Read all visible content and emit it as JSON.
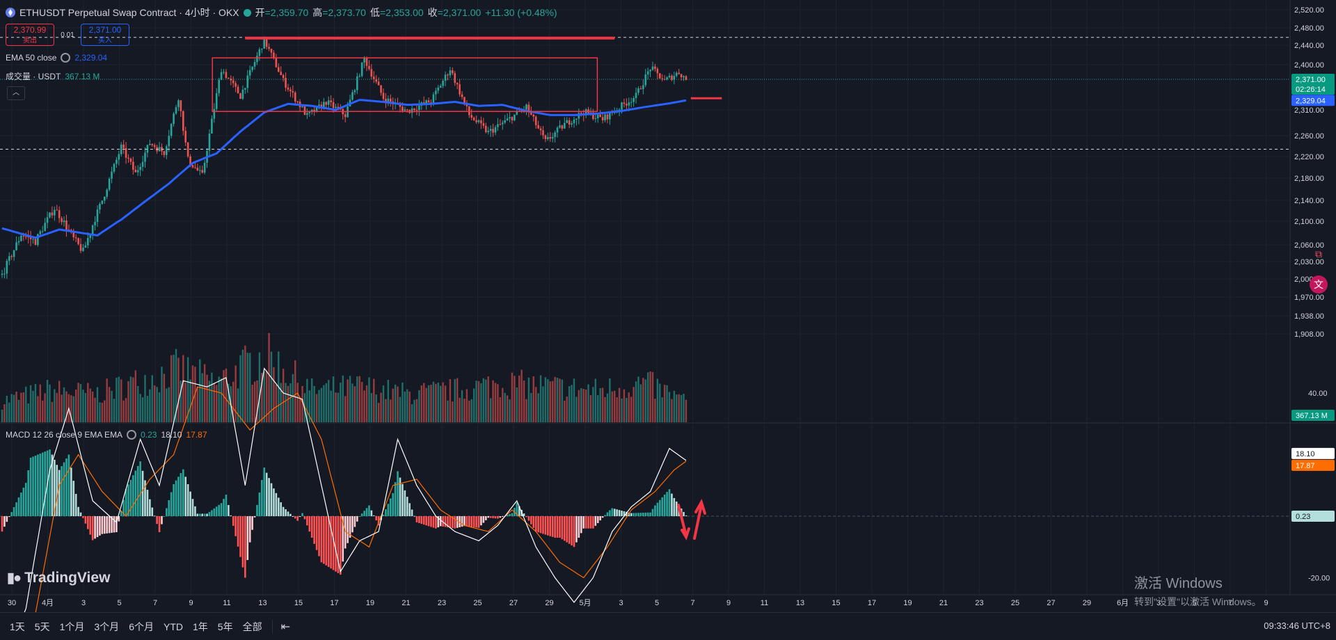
{
  "header": {
    "symbol": "ETHUSDT Perpetual Swap Contract · 4小时 · OKX",
    "open_label": "开",
    "open_value": "=2,359.70",
    "high_label": "高",
    "high_value": "=2,373.70",
    "low_label": "低",
    "low_value": "=2,353.00",
    "close_label": "收",
    "close_value": "=2,371.00",
    "change": "+11.30 (+0.48%)"
  },
  "trade": {
    "sell_price": "2,370.99",
    "sell_label": "卖出",
    "spread": "0.01",
    "buy_price": "2,371.00",
    "buy_label": "买入"
  },
  "legends": {
    "ema_label": "EMA 50 close",
    "ema_value": "2,329.04",
    "volume_label": "成交量 · USDT",
    "volume_value": "367.13 M",
    "macd_label": "MACD 12 26 close 9 EMA EMA",
    "macd_hist": "0.23",
    "macd_line": "18.10",
    "macd_signal": "17.87"
  },
  "brand": {
    "name": "TradingView"
  },
  "watermark": {
    "line1": "激活 Windows",
    "line2": "转到\"设置\"以激活 Windows。"
  },
  "bottom_bar": {
    "ranges": [
      "1天",
      "5天",
      "1个月",
      "3个月",
      "6个月",
      "YTD",
      "1年",
      "5年",
      "全部"
    ],
    "clock": "09:33:46 UTC+8"
  },
  "colors": {
    "bull": "#26a69a",
    "bear": "#ef5350",
    "ema": "#2962ff",
    "annotation": "#f23645",
    "macd_line": "#ffffff",
    "signal": "#ff6d00"
  },
  "icons": [
    "calendar-range-icon",
    "camera-icon",
    "translate-icon",
    "live-dot-icon",
    "indicator-settings-icon"
  ],
  "chart_data": [
    {
      "type": "candlestick",
      "title": "ETHUSDT Perpetual Swap Contract · 4小时 · OKX",
      "timeframe": "4h",
      "price_axis_ticks": [
        "2,520.00",
        "2,480.00",
        "2,440.00",
        "2,400.00",
        "2,310.00",
        "2,260.00",
        "2,220.00",
        "2,180.00",
        "2,140.00",
        "2,100.00",
        "2,060.00",
        "2,030.00",
        "2,000.00",
        "1,970.00",
        "1,938.00",
        "1,908.00"
      ],
      "time_axis_ticks": [
        "30",
        "4月",
        "3",
        "5",
        "7",
        "9",
        "11",
        "13",
        "15",
        "17",
        "19",
        "21",
        "23",
        "25",
        "27",
        "29",
        "5月",
        "3",
        "5",
        "7",
        "9",
        "11",
        "13",
        "15",
        "17",
        "19",
        "21",
        "23",
        "25",
        "27",
        "29",
        "6月",
        "3",
        "5",
        "7",
        "9"
      ],
      "last_price": "2,371.00",
      "countdown": "02:26:14",
      "ema50_last": "2,329.04",
      "volume_last": "367.13 M",
      "price_path": [
        {
          "t": 0,
          "p": 2007
        },
        {
          "t": 8,
          "p": 2078
        },
        {
          "t": 14,
          "p": 2066
        },
        {
          "t": 22,
          "p": 2125
        },
        {
          "t": 30,
          "p": 2070
        },
        {
          "t": 34,
          "p": 2048
        },
        {
          "t": 42,
          "p": 2140
        },
        {
          "t": 50,
          "p": 2238
        },
        {
          "t": 56,
          "p": 2188
        },
        {
          "t": 62,
          "p": 2246
        },
        {
          "t": 68,
          "p": 2228
        },
        {
          "t": 74,
          "p": 2336
        },
        {
          "t": 78,
          "p": 2214
        },
        {
          "t": 84,
          "p": 2184
        },
        {
          "t": 92,
          "p": 2392
        },
        {
          "t": 100,
          "p": 2338
        },
        {
          "t": 110,
          "p": 2451
        },
        {
          "t": 118,
          "p": 2368
        },
        {
          "t": 128,
          "p": 2298
        },
        {
          "t": 136,
          "p": 2326
        },
        {
          "t": 144,
          "p": 2300
        },
        {
          "t": 152,
          "p": 2412
        },
        {
          "t": 160,
          "p": 2334
        },
        {
          "t": 170,
          "p": 2308
        },
        {
          "t": 180,
          "p": 2328
        },
        {
          "t": 188,
          "p": 2392
        },
        {
          "t": 196,
          "p": 2300
        },
        {
          "t": 204,
          "p": 2266
        },
        {
          "t": 212,
          "p": 2290
        },
        {
          "t": 220,
          "p": 2316
        },
        {
          "t": 228,
          "p": 2248
        },
        {
          "t": 236,
          "p": 2282
        },
        {
          "t": 244,
          "p": 2306
        },
        {
          "t": 252,
          "p": 2292
        },
        {
          "t": 260,
          "p": 2318
        },
        {
          "t": 266,
          "p": 2338
        },
        {
          "t": 272,
          "p": 2394
        },
        {
          "t": 278,
          "p": 2368
        },
        {
          "t": 284,
          "p": 2385
        },
        {
          "t": 287,
          "p": 2371
        }
      ],
      "ema50_path": [
        {
          "t": 0,
          "p": 2088
        },
        {
          "t": 14,
          "p": 2072
        },
        {
          "t": 24,
          "p": 2086
        },
        {
          "t": 40,
          "p": 2076
        },
        {
          "t": 50,
          "p": 2103
        },
        {
          "t": 60,
          "p": 2138
        },
        {
          "t": 70,
          "p": 2170
        },
        {
          "t": 80,
          "p": 2208
        },
        {
          "t": 90,
          "p": 2226
        },
        {
          "t": 100,
          "p": 2268
        },
        {
          "t": 110,
          "p": 2305
        },
        {
          "t": 120,
          "p": 2322
        },
        {
          "t": 130,
          "p": 2318
        },
        {
          "t": 140,
          "p": 2310
        },
        {
          "t": 150,
          "p": 2330
        },
        {
          "t": 160,
          "p": 2326
        },
        {
          "t": 170,
          "p": 2320
        },
        {
          "t": 180,
          "p": 2322
        },
        {
          "t": 190,
          "p": 2326
        },
        {
          "t": 200,
          "p": 2318
        },
        {
          "t": 210,
          "p": 2320
        },
        {
          "t": 220,
          "p": 2308
        },
        {
          "t": 230,
          "p": 2300
        },
        {
          "t": 240,
          "p": 2300
        },
        {
          "t": 250,
          "p": 2303
        },
        {
          "t": 260,
          "p": 2308
        },
        {
          "t": 270,
          "p": 2316
        },
        {
          "t": 280,
          "p": 2323
        },
        {
          "t": 287,
          "p": 2329
        }
      ],
      "annotations": {
        "resistance_line": 2458,
        "support_line": 2234,
        "consolidation_box": {
          "t_start": 90,
          "t_end": 248,
          "p_high": 2414,
          "p_low": 2307
        },
        "ema_marker": 2329
      }
    },
    {
      "type": "bar",
      "title": "成交量 · USDT",
      "last_value": "367.13 M",
      "relative_volume_path": [
        {
          "t": 0,
          "v": 0.3
        },
        {
          "t": 20,
          "v": 0.45
        },
        {
          "t": 40,
          "v": 0.4
        },
        {
          "t": 60,
          "v": 0.6
        },
        {
          "t": 74,
          "v": 0.75
        },
        {
          "t": 90,
          "v": 0.55
        },
        {
          "t": 110,
          "v": 0.95
        },
        {
          "t": 130,
          "v": 0.45
        },
        {
          "t": 150,
          "v": 0.5
        },
        {
          "t": 170,
          "v": 0.4
        },
        {
          "t": 190,
          "v": 0.45
        },
        {
          "t": 210,
          "v": 0.55
        },
        {
          "t": 230,
          "v": 0.5
        },
        {
          "t": 250,
          "v": 0.45
        },
        {
          "t": 270,
          "v": 0.55
        },
        {
          "t": 287,
          "v": 0.3
        }
      ]
    },
    {
      "type": "line",
      "title": "MACD 12 26 close 9 EMA EMA",
      "axis_ticks": [
        "40.00",
        "-20.00"
      ],
      "last_values": {
        "histogram": "0.23",
        "macd": "18.10",
        "signal": "17.87"
      },
      "macd_path": [
        {
          "t": 0,
          "v": -50
        },
        {
          "t": 10,
          "v": -30
        },
        {
          "t": 20,
          "v": 15
        },
        {
          "t": 28,
          "v": 35
        },
        {
          "t": 38,
          "v": 5
        },
        {
          "t": 48,
          "v": -2
        },
        {
          "t": 58,
          "v": 25
        },
        {
          "t": 66,
          "v": 10
        },
        {
          "t": 76,
          "v": 44
        },
        {
          "t": 86,
          "v": 42
        },
        {
          "t": 94,
          "v": 45
        },
        {
          "t": 102,
          "v": 10
        },
        {
          "t": 110,
          "v": 48
        },
        {
          "t": 118,
          "v": 40
        },
        {
          "t": 126,
          "v": 38
        },
        {
          "t": 134,
          "v": 10
        },
        {
          "t": 142,
          "v": -18
        },
        {
          "t": 150,
          "v": -8
        },
        {
          "t": 158,
          "v": -5
        },
        {
          "t": 166,
          "v": 25
        },
        {
          "t": 174,
          "v": 10
        },
        {
          "t": 182,
          "v": 0
        },
        {
          "t": 190,
          "v": -5
        },
        {
          "t": 200,
          "v": -8
        },
        {
          "t": 208,
          "v": -3
        },
        {
          "t": 216,
          "v": 5
        },
        {
          "t": 224,
          "v": -10
        },
        {
          "t": 232,
          "v": -20
        },
        {
          "t": 240,
          "v": -28
        },
        {
          "t": 248,
          "v": -20
        },
        {
          "t": 256,
          "v": -5
        },
        {
          "t": 264,
          "v": 3
        },
        {
          "t": 272,
          "v": 8
        },
        {
          "t": 280,
          "v": 22
        },
        {
          "t": 287,
          "v": 18.1
        }
      ],
      "signal_path": [
        {
          "t": 0,
          "v": -45
        },
        {
          "t": 12,
          "v": -40
        },
        {
          "t": 24,
          "v": 10
        },
        {
          "t": 32,
          "v": 20
        },
        {
          "t": 42,
          "v": 8
        },
        {
          "t": 52,
          "v": 0
        },
        {
          "t": 62,
          "v": 12
        },
        {
          "t": 72,
          "v": 20
        },
        {
          "t": 82,
          "v": 42
        },
        {
          "t": 92,
          "v": 40
        },
        {
          "t": 104,
          "v": 28
        },
        {
          "t": 114,
          "v": 35
        },
        {
          "t": 124,
          "v": 40
        },
        {
          "t": 134,
          "v": 25
        },
        {
          "t": 144,
          "v": -5
        },
        {
          "t": 154,
          "v": -10
        },
        {
          "t": 164,
          "v": 10
        },
        {
          "t": 174,
          "v": 12
        },
        {
          "t": 184,
          "v": 2
        },
        {
          "t": 194,
          "v": -3
        },
        {
          "t": 204,
          "v": -5
        },
        {
          "t": 214,
          "v": 2
        },
        {
          "t": 224,
          "v": -5
        },
        {
          "t": 234,
          "v": -15
        },
        {
          "t": 244,
          "v": -20
        },
        {
          "t": 254,
          "v": -10
        },
        {
          "t": 264,
          "v": 2
        },
        {
          "t": 274,
          "v": 8
        },
        {
          "t": 282,
          "v": 15
        },
        {
          "t": 287,
          "v": 17.87
        }
      ]
    }
  ]
}
